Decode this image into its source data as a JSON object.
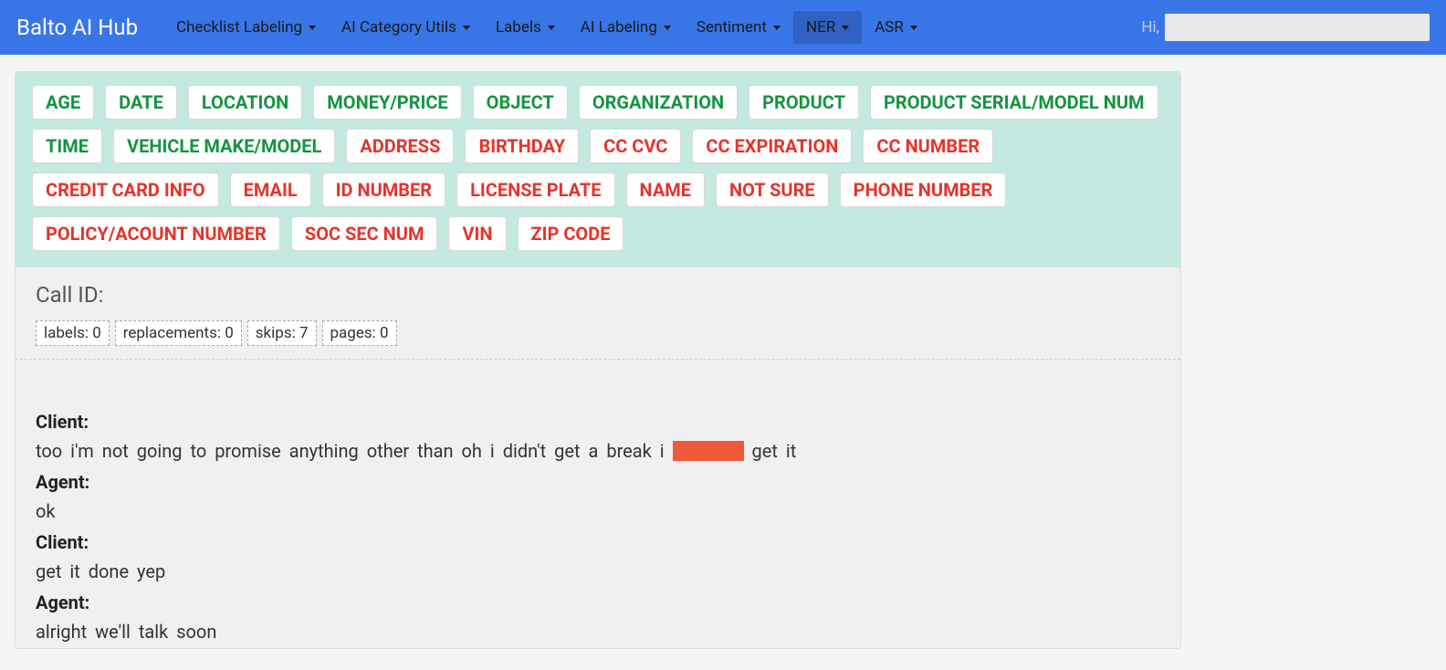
{
  "brand": "Balto AI Hub",
  "nav": [
    {
      "label": "Checklist Labeling",
      "active": false
    },
    {
      "label": "AI Category Utils",
      "active": false
    },
    {
      "label": "Labels",
      "active": false
    },
    {
      "label": "AI Labeling",
      "active": false
    },
    {
      "label": "Sentiment",
      "active": false
    },
    {
      "label": "NER",
      "active": true
    },
    {
      "label": "ASR",
      "active": false
    }
  ],
  "greeting": "Hi,",
  "tags_green": [
    "AGE",
    "DATE",
    "LOCATION",
    "MONEY/PRICE",
    "OBJECT",
    "ORGANIZATION",
    "PRODUCT",
    "PRODUCT SERIAL/MODEL NUM",
    "TIME",
    "VEHICLE MAKE/MODEL"
  ],
  "tags_red": [
    "ADDRESS",
    "BIRTHDAY",
    "CC CVC",
    "CC EXPIRATION",
    "CC NUMBER",
    "CREDIT CARD INFO",
    "EMAIL",
    "ID NUMBER",
    "LICENSE PLATE",
    "NAME",
    "NOT SURE",
    "PHONE NUMBER",
    "POLICY/ACOUNT NUMBER",
    "SOC SEC NUM",
    "VIN",
    "ZIP CODE"
  ],
  "call_id_label": "Call ID:",
  "stats": {
    "labels_label": "labels:",
    "labels_value": "0",
    "replacements_label": "replacements:",
    "replacements_value": "0",
    "skips_label": "skips:",
    "skips_value": "7",
    "pages_label": "pages:",
    "pages_value": "0"
  },
  "transcript": [
    {
      "speaker": "Client:",
      "text_pre": "too i'm not going to promise anything other than oh i didn't get a break i ",
      "redacted": true,
      "text_post": " get it"
    },
    {
      "speaker": "Agent:",
      "text_pre": "ok",
      "redacted": false,
      "text_post": ""
    },
    {
      "speaker": "Client:",
      "text_pre": "get it done yep",
      "redacted": false,
      "text_post": ""
    },
    {
      "speaker": "Agent:",
      "text_pre": "alright we'll talk soon",
      "redacted": false,
      "text_post": ""
    }
  ]
}
